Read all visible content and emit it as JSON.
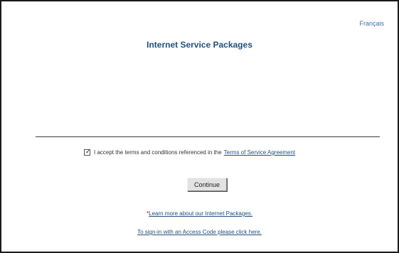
{
  "header": {
    "language_link": "Français",
    "title": "Internet Service Packages"
  },
  "terms": {
    "checked": true,
    "text": "I accept the terms and conditions referenced in the",
    "link_label": "Terms of Service Agreement"
  },
  "actions": {
    "continue_label": "Continue"
  },
  "links": {
    "asterisk": "*",
    "learn_more": "Learn more about our Internet Packages.",
    "sign_in": "To sign-in with an Access Code please click here."
  },
  "icons": {
    "checkbox_mark": "check-icon"
  },
  "colors": {
    "link": "#21507f",
    "title": "#21507f",
    "asterisk": "#cc0000"
  }
}
